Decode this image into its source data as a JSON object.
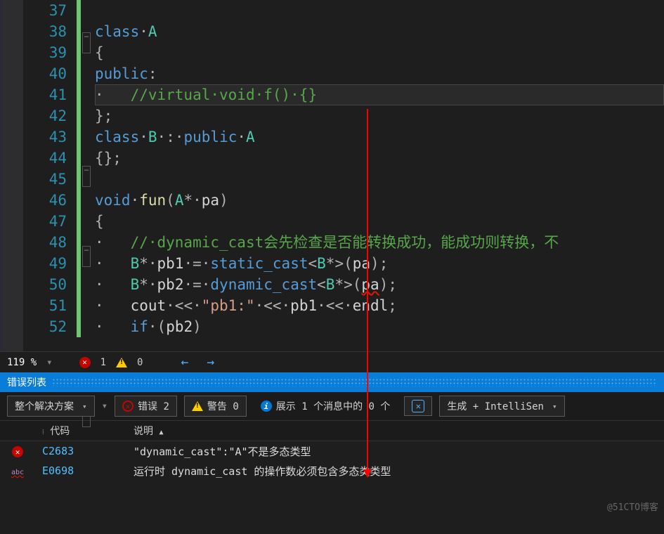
{
  "lines": [
    {
      "n": "37",
      "fold": "",
      "html": ""
    },
    {
      "n": "38",
      "fold": "⊟",
      "html": "<span class='kw'>class</span><span class='op'>·</span><span class='ty'>A</span>"
    },
    {
      "n": "39",
      "fold": "",
      "html": "<span class='pn'>{</span>"
    },
    {
      "n": "40",
      "fold": "",
      "html": "<span class='kw'>public</span><span class='pn'>:</span>"
    },
    {
      "n": "41",
      "fold": "",
      "hl": true,
      "html": "<span class='op'>·   </span><span class='cm'>//virtual·void·f()·{}</span>"
    },
    {
      "n": "42",
      "fold": "",
      "html": "<span class='pn'>};</span>"
    },
    {
      "n": "43",
      "fold": "⊟",
      "html": "<span class='kw'>class</span><span class='op'>·</span><span class='ty'>B</span><span class='op'>·</span><span class='pn'>:</span><span class='op'>·</span><span class='kw'>public</span><span class='op'>·</span><span class='ty'>A</span>"
    },
    {
      "n": "44",
      "fold": "",
      "html": "<span class='pn'>{};</span>"
    },
    {
      "n": "45",
      "fold": "",
      "html": ""
    },
    {
      "n": "46",
      "fold": "⊟",
      "html": "<span class='kw'>void</span><span class='op'>·</span><span class='fn'>fun</span><span class='pn'>(</span><span class='ty'>A</span><span class='op'>*·</span><span class='tx'>pa</span><span class='pn'>)</span>"
    },
    {
      "n": "47",
      "fold": "",
      "html": "<span class='pn'>{</span>"
    },
    {
      "n": "48",
      "fold": "",
      "html": "<span class='op'>·   </span><span class='cm'>//·dynamic_cast会先检查是否能转换成功，能成功则转换，不</span>"
    },
    {
      "n": "49",
      "fold": "",
      "html": "<span class='op'>·   </span><span class='ty'>B</span><span class='op'>*·</span><span class='tx'>pb1</span><span class='op'>·=·</span><span class='kw'>static_cast</span><span class='pn'>&lt;</span><span class='ty'>B</span><span class='op'>*</span><span class='pn'>&gt;(</span><span class='tx'>pa</span><span class='pn'>);</span>"
    },
    {
      "n": "50",
      "fold": "",
      "html": "<span class='op'>·   </span><span class='ty'>B</span><span class='op'>*·</span><span class='tx'>pb2</span><span class='op'>·=·</span><span class='kw'>dynamic_cast</span><span class='pn'>&lt;</span><span class='ty'>B</span><span class='op'>*</span><span class='pn'>&gt;(</span><span class='tx squig'>pa</span><span class='pn'>);</span>"
    },
    {
      "n": "51",
      "fold": "",
      "html": "<span class='op'>·   </span><span class='tx'>cout</span><span class='op'>·&lt;&lt;·</span><span class='str'>\"pb1:\"</span><span class='op'>·&lt;&lt;·</span><span class='tx'>pb1</span><span class='op'>·&lt;&lt;·</span><span class='tx'>endl</span><span class='pn'>;</span>"
    },
    {
      "n": "52",
      "fold": "⊟",
      "html": "<span class='op'>·   </span><span class='kw'>if</span><span class='op'>·</span><span class='pn'>(</span><span class='tx'>pb2</span><span class='pn'>)</span>"
    }
  ],
  "status": {
    "zoom": "119 %",
    "err": "1",
    "warn": "0"
  },
  "errlist": {
    "title": "错误列表",
    "scope": "整个解决方案",
    "btnErr": "错误 2",
    "btnWarn": "警告 0",
    "btnInfo": "展示 1 个消息中的 0 个",
    "build": "生成 + IntelliSen",
    "hCode": "代码",
    "hDesc": "说明",
    "rows": [
      {
        "icon": "x",
        "code": "C2683",
        "desc": "\"dynamic_cast\":\"A\"不是多态类型"
      },
      {
        "icon": "abc",
        "code": "E0698",
        "desc": "运行时 dynamic_cast 的操作数必须包含多态类类型"
      }
    ]
  },
  "watermark": "@51CTO博客"
}
